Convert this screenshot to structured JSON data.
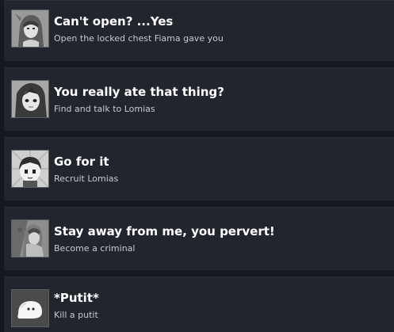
{
  "achievements": [
    {
      "title": "Can't open? ...Yes",
      "description": "Open the locked chest Fiama gave you",
      "icon": "portrait-woman-icon"
    },
    {
      "title": "You really ate that thing?",
      "description": "Find and talk to Lomias",
      "icon": "portrait-girl-icon"
    },
    {
      "title": "Go for it",
      "description": "Recruit Lomias",
      "icon": "portrait-boy-icon"
    },
    {
      "title": "Stay away from me, you pervert!",
      "description": "Become a criminal",
      "icon": "portrait-elf-icon"
    },
    {
      "title": "*Putit*",
      "description": "Kill a putit",
      "icon": "putit-slime-icon"
    }
  ]
}
